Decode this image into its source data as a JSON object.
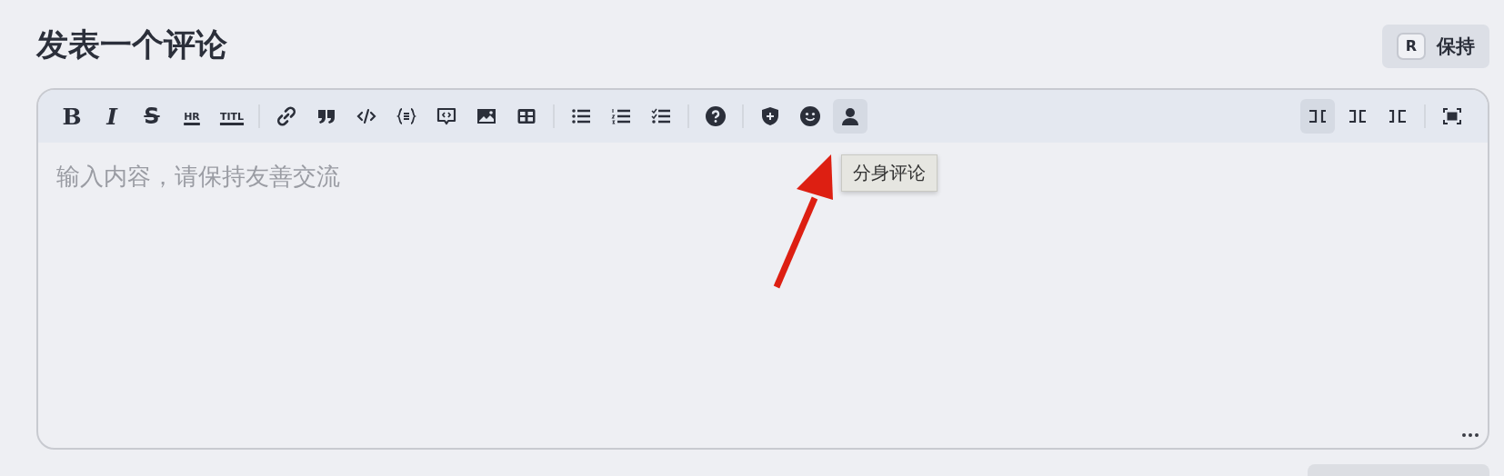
{
  "title": "发表一个评论",
  "keep_button": {
    "key": "R",
    "label": "保持"
  },
  "toolbar": {
    "left_groups": [
      [
        {
          "kind": "bold",
          "glyph": "B",
          "selected": false
        },
        {
          "kind": "italic",
          "glyph": "I",
          "selected": false
        },
        {
          "kind": "strike",
          "glyph": "S",
          "selected": false
        },
        {
          "kind": "underlined",
          "glyph": "HR",
          "selected": false
        },
        {
          "kind": "underlined",
          "glyph": "TITL",
          "selected": false
        }
      ],
      [
        {
          "kind": "link",
          "selected": false
        },
        {
          "kind": "quote",
          "selected": false
        },
        {
          "kind": "code",
          "selected": false
        },
        {
          "kind": "codeblock",
          "selected": false
        },
        {
          "kind": "comment",
          "selected": false
        },
        {
          "kind": "image",
          "selected": false
        },
        {
          "kind": "table",
          "selected": false
        }
      ],
      [
        {
          "kind": "bullets",
          "selected": false
        },
        {
          "kind": "numbers",
          "selected": false
        },
        {
          "kind": "tasks",
          "selected": false
        }
      ],
      [
        {
          "kind": "help",
          "selected": false
        }
      ],
      [
        {
          "kind": "shield",
          "selected": false
        },
        {
          "kind": "smile",
          "selected": false
        },
        {
          "kind": "person",
          "selected": true
        }
      ]
    ],
    "right_groups": [
      [
        {
          "kind": "layout-left",
          "selected": true
        },
        {
          "kind": "layout-center",
          "selected": false
        },
        {
          "kind": "layout-right",
          "selected": false
        }
      ],
      [
        {
          "kind": "fullscreen",
          "selected": false
        }
      ]
    ]
  },
  "editor": {
    "placeholder": "输入内容，请保持友善交流"
  },
  "tooltip": "分身评论"
}
